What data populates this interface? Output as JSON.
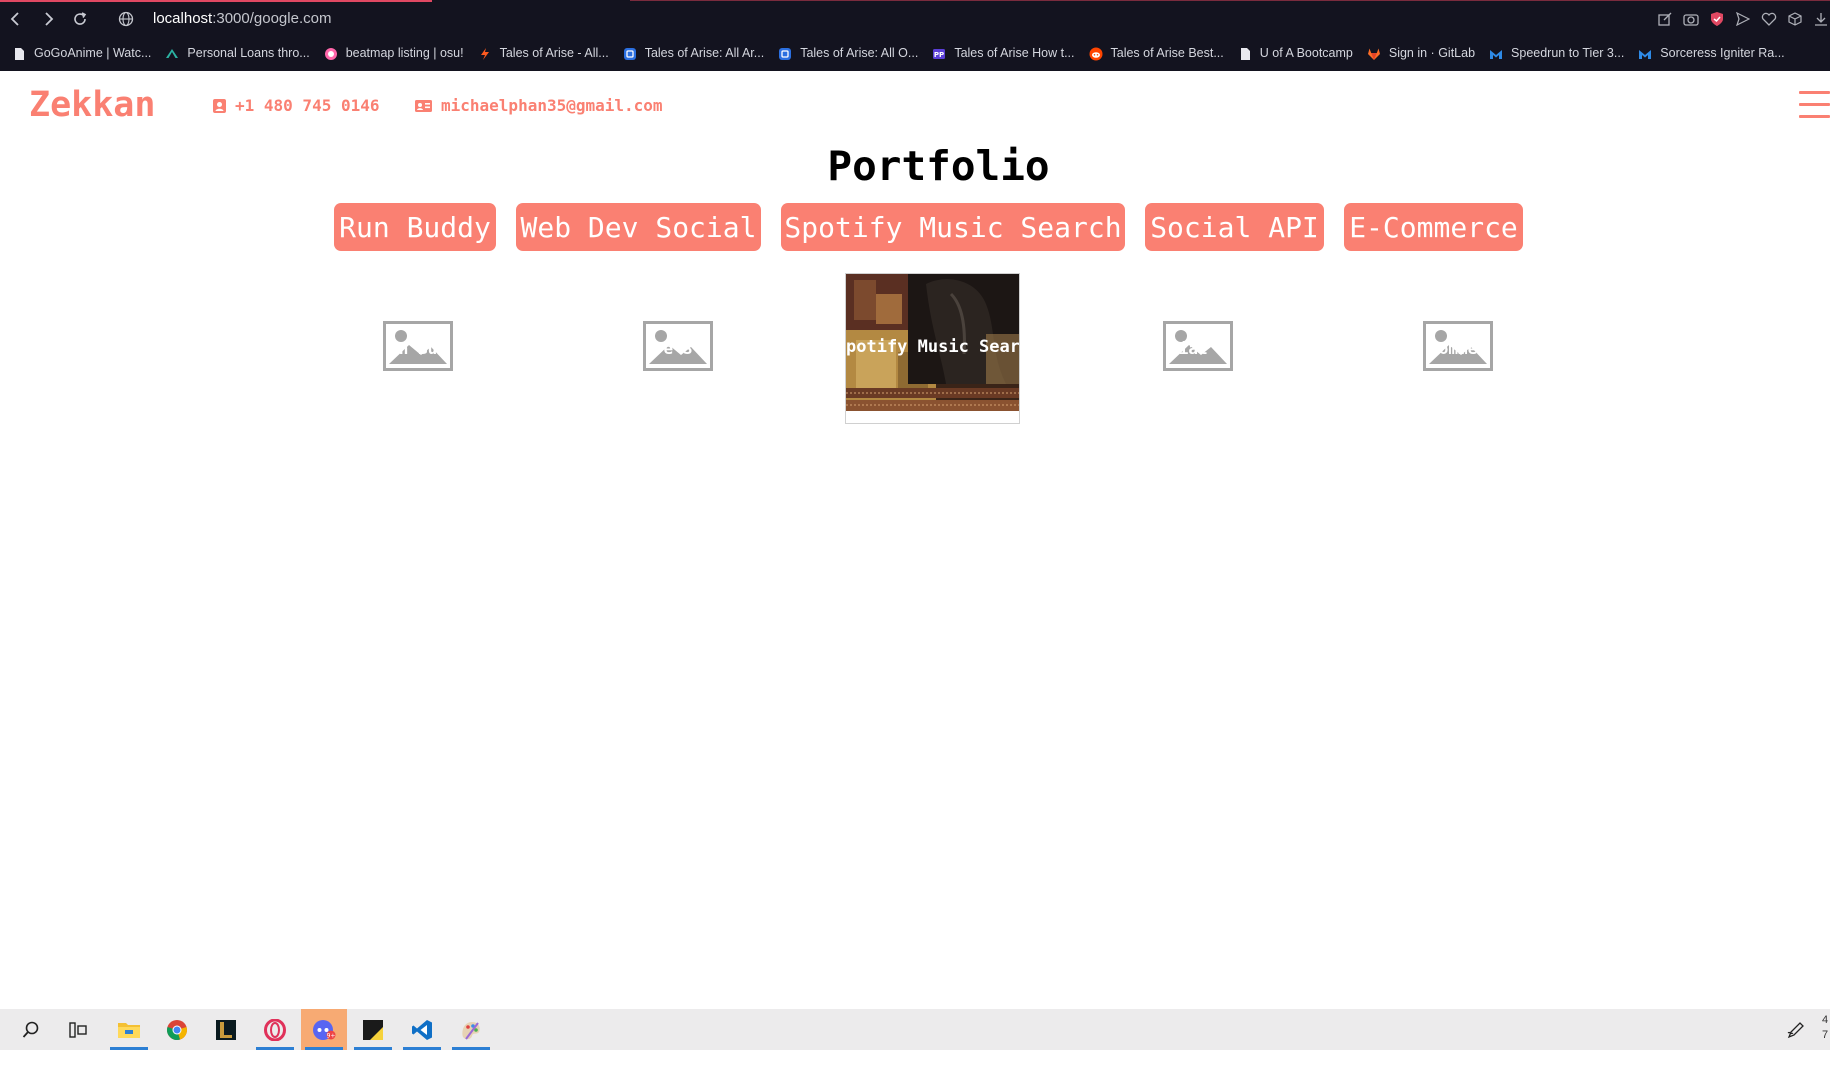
{
  "browser": {
    "url_host": "localhost",
    "url_path": ":3000/google.com",
    "bookmarks": [
      {
        "label": "GoGoAnime | Watc...",
        "icon": "document-icon"
      },
      {
        "label": "Personal Loans thro...",
        "icon": "loan-icon"
      },
      {
        "label": "beatmap listing | osu!",
        "icon": "osu-icon"
      },
      {
        "label": "Tales of Arise - All...",
        "icon": "bolt-icon"
      },
      {
        "label": "Tales of Arise: All Ar...",
        "icon": "square-app-icon"
      },
      {
        "label": "Tales of Arise: All O...",
        "icon": "square-app-icon"
      },
      {
        "label": "Tales of Arise How t...",
        "icon": "pp-icon"
      },
      {
        "label": "Tales of Arise Best...",
        "icon": "reddit-icon"
      },
      {
        "label": "U of A Bootcamp",
        "icon": "document-icon"
      },
      {
        "label": "Sign in · GitLab",
        "icon": "gitlab-icon"
      },
      {
        "label": "Speedrun to Tier 3...",
        "icon": "m-logo-icon"
      },
      {
        "label": "Sorceress Igniter Ra...",
        "icon": "m-logo-icon"
      }
    ]
  },
  "site": {
    "brand": "Zekkan",
    "phone": "+1 480 745 0146",
    "email": "michaelphan35@gmail.com",
    "title": "Portfolio",
    "projects": [
      "Run Buddy",
      "Web Dev Social",
      "Spotify Music Search",
      "Social API",
      "E-Commerce"
    ],
    "card_overlays": [
      "n Bu",
      "e S",
      "potify Music Sear",
      "cial A",
      "omme"
    ]
  },
  "colors": {
    "accent": "#fa8072",
    "browser_bg": "#13131f",
    "taskbar_bg": "#ecebec"
  },
  "taskbar": {
    "items": [
      "search-icon",
      "task-view-icon",
      "file-explorer-icon",
      "chrome-icon",
      "league-icon",
      "opera-icon",
      "discord-icon",
      "sticky-notes-icon",
      "vscode-icon",
      "paint-icon"
    ],
    "active_index": 6,
    "tray_time": "4",
    "tray_date": "7"
  }
}
